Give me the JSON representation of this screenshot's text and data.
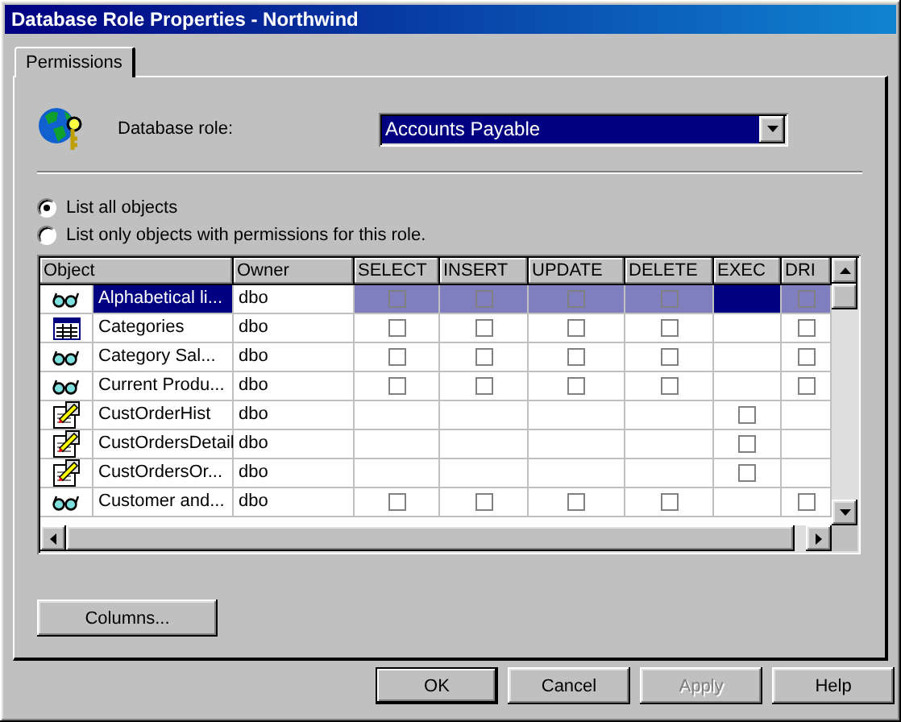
{
  "window": {
    "title": "Database Role Properties - Northwind"
  },
  "tabs": [
    {
      "label": "Permissions",
      "selected": true
    }
  ],
  "role": {
    "label": "Database role:",
    "value": "Accounts Payable"
  },
  "filters": [
    {
      "label": "List all objects",
      "selected": true
    },
    {
      "label": "List only objects with permissions for this role.",
      "selected": false
    }
  ],
  "table": {
    "columns": [
      "Object",
      "Owner",
      "SELECT",
      "INSERT",
      "UPDATE",
      "DELETE",
      "EXEC",
      "DRI"
    ],
    "rows": [
      {
        "kind": "view",
        "name": "Alphabetical li...",
        "owner": "dbo",
        "selected": true,
        "permissions": [
          false,
          false,
          false,
          false,
          false
        ]
      },
      {
        "kind": "table",
        "name": "Categories",
        "owner": "dbo",
        "selected": false,
        "permissions": [
          false,
          false,
          false,
          false,
          false
        ]
      },
      {
        "kind": "view",
        "name": "Category Sal...",
        "owner": "dbo",
        "selected": false,
        "permissions": [
          false,
          false,
          false,
          false,
          false
        ]
      },
      {
        "kind": "view",
        "name": "Current Produ...",
        "owner": "dbo",
        "selected": false,
        "permissions": [
          false,
          false,
          false,
          false,
          false
        ]
      },
      {
        "kind": "procedure",
        "name": "CustOrderHist",
        "owner": "dbo",
        "selected": false,
        "permissions": [
          false
        ]
      },
      {
        "kind": "procedure",
        "name": "CustOrdersDetail",
        "owner": "dbo",
        "selected": false,
        "permissions": [
          false
        ]
      },
      {
        "kind": "procedure",
        "name": "CustOrdersOr...",
        "owner": "dbo",
        "selected": false,
        "permissions": [
          false
        ]
      },
      {
        "kind": "view",
        "name": "Customer and...",
        "owner": "dbo",
        "selected": false,
        "permissions": [
          false,
          false,
          false,
          false,
          false
        ]
      }
    ]
  },
  "columns_button": "Columns...",
  "buttons": [
    {
      "label": "OK",
      "default": true,
      "disabled": false
    },
    {
      "label": "Cancel",
      "default": false,
      "disabled": false
    },
    {
      "label": "Apply",
      "default": false,
      "disabled": true
    },
    {
      "label": "Help",
      "default": false,
      "disabled": false
    }
  ]
}
